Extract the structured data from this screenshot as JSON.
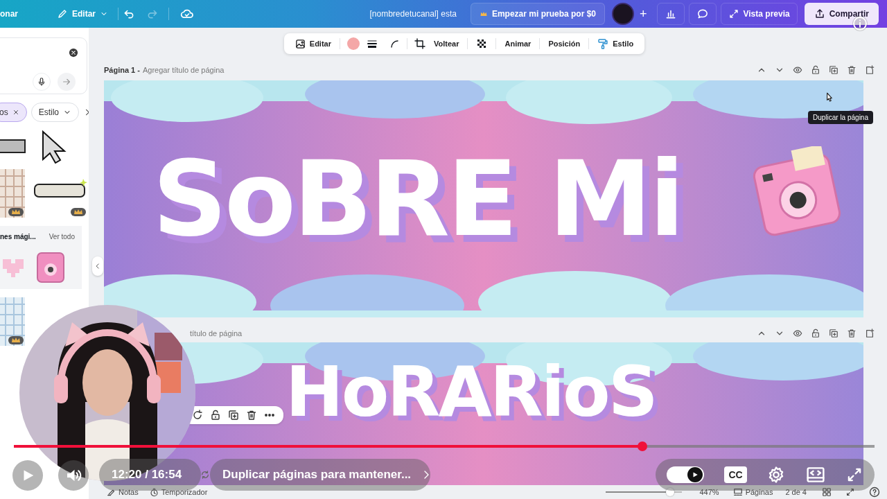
{
  "topbar": {
    "partial_button": "onar",
    "edit_menu": "Editar",
    "undo": {
      "disabled": false
    },
    "redo": {
      "disabled": true
    },
    "design_name": "[nombredetucanal] esta",
    "trial_button": "Empezar mi prueba por $0",
    "add_button": "+",
    "preview_button": "Vista previa",
    "share_button": "Compartir"
  },
  "side_panel": {
    "filter_chips": [
      {
        "label": "os",
        "selected": true
      },
      {
        "label": "Estilo",
        "selected": false
      }
    ],
    "section_title": "nes mági...",
    "see_all": "Ver todo"
  },
  "floating_toolbar": {
    "edit": "Editar",
    "flip": "Voltear",
    "animate": "Animar",
    "position": "Posición",
    "style": "Estilo"
  },
  "pages": [
    {
      "label": "Página 1 -",
      "title_placeholder": "Agregar título de página",
      "heading": "SoBRE Mi"
    },
    {
      "title_placeholder": "título de página",
      "heading": "HoRARioS"
    }
  ],
  "tooltip": "Duplicar la página",
  "status_bar": {
    "notes": "Notas",
    "timer": "Temporizador",
    "zoom_slider": {
      "level": 0.85
    },
    "zoom": "447%",
    "pages": "Páginas",
    "page_count": "2 de 4"
  },
  "player": {
    "progress": {
      "level": 0.73
    },
    "time": "12:20 / 16:54",
    "chapter": "Duplicar páginas para mantener...",
    "autoplay": {
      "on": true
    },
    "captions": "CC"
  }
}
